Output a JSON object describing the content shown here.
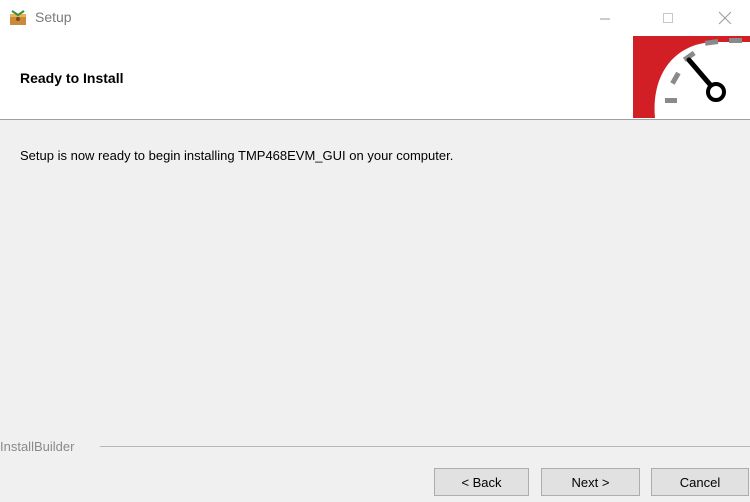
{
  "window": {
    "title": "Setup",
    "icon": "installer-box-icon",
    "controls": [
      "minimize-icon",
      "maximize-icon",
      "close-icon"
    ]
  },
  "header": {
    "title": "Ready to Install",
    "logo": "speedometer-gauge-icon"
  },
  "content": {
    "message": "Setup is now ready to begin installing TMP468EVM_GUI on your computer."
  },
  "footer": {
    "brand": "InstallBuilder",
    "buttons": {
      "back": "< Back",
      "next": "Next >",
      "cancel": "Cancel"
    }
  },
  "colors": {
    "accent_red": "#d21f26",
    "content_bg": "#f0f0f0",
    "button_bg": "#e1e1e1"
  }
}
